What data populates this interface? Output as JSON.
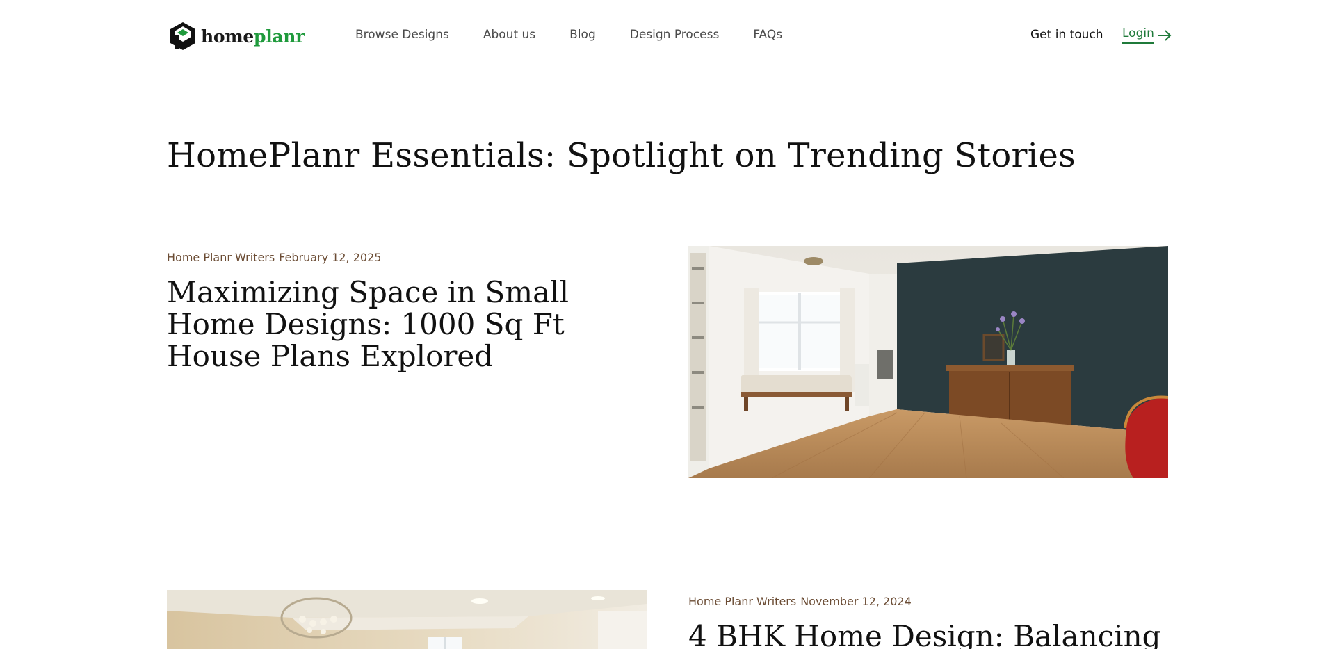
{
  "header": {
    "logo_text_home": "home",
    "logo_text_planr": "planr",
    "nav": [
      "Browse Designs",
      "About us",
      "Blog",
      "Design Process",
      "FAQs"
    ],
    "get_in_touch": "Get in touch",
    "login": "Login"
  },
  "page_title": "HomePlanr Essentials: Spotlight on Trending Stories",
  "articles": [
    {
      "author": "Home Planr Writers",
      "date": "February 12, 2025",
      "title": "Maximizing Space in Small Home Designs: 1000 Sq Ft House Plans Explored",
      "image": "living-room-photo"
    },
    {
      "author": "Home Planr Writers",
      "date": "November 12, 2024",
      "title": "4 BHK Home Design: Balancing",
      "image": "chandelier-room-photo"
    }
  ],
  "colors": {
    "accent_green": "#1f9a3c",
    "meta_brown": "#6b4c34",
    "wall_teal": "#2b3b3f",
    "floor_wood": "#b8895a"
  }
}
